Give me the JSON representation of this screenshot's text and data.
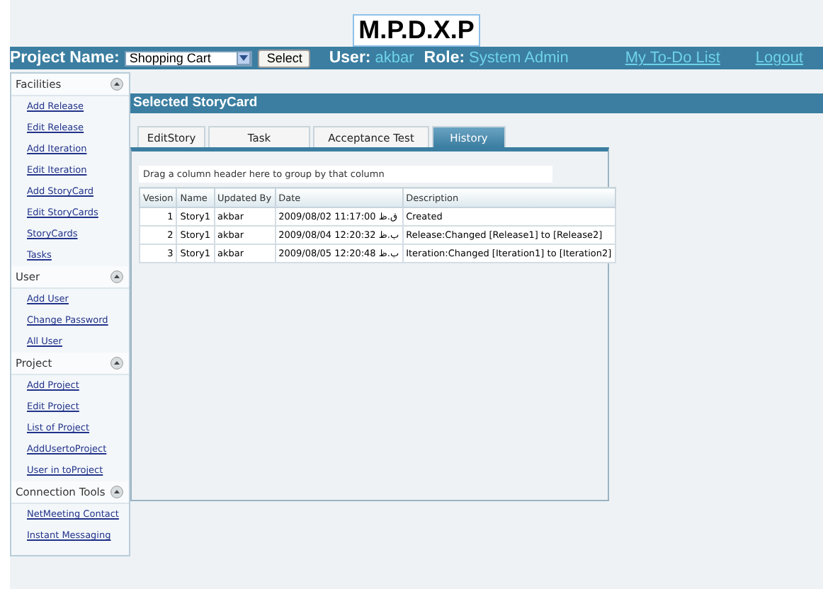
{
  "app_title": "M.P.D.X.P",
  "header": {
    "project_label": "Project Name:",
    "project_value": "Shopping Cart",
    "select_button": "Select",
    "user_label": "User:",
    "user_value": "akbar",
    "role_label": "Role:",
    "role_value": "System Admin",
    "todo_link": "My To-Do List",
    "logout_link": "Logout"
  },
  "sidebar": [
    {
      "title": "Facilities",
      "expanded": true,
      "items": [
        "Add Release",
        "Edit Release",
        "Add Iteration",
        "Edit Iteration",
        "Add StoryCard",
        "Edit StoryCards",
        "StoryCards",
        "Tasks"
      ]
    },
    {
      "title": "User",
      "expanded": true,
      "items": [
        "Add User",
        "Change Password",
        "All User"
      ]
    },
    {
      "title": "Project",
      "expanded": true,
      "items": [
        "Add Project",
        "Edit Project",
        "List of Project",
        "AddUsertoProject",
        "User in toProject"
      ]
    },
    {
      "title": "Connection Tools",
      "expanded": true,
      "items": [
        "NetMeeting Contact",
        "Instant Messaging"
      ]
    }
  ],
  "section_title": "Selected StoryCard",
  "tabs": [
    {
      "label": "EditStory",
      "selected": false
    },
    {
      "label": "Task",
      "selected": false
    },
    {
      "label": "Acceptance Test",
      "selected": false
    },
    {
      "label": "History",
      "selected": true
    }
  ],
  "group_hint": "Drag a column header here to group by that column",
  "table": {
    "columns": [
      "Vesion",
      "Name",
      "Updated By",
      "Date",
      "Description"
    ],
    "rows": [
      [
        "1",
        "Story1",
        "akbar",
        "2009/08/02 11:17:00 ق.ظ",
        "Created"
      ],
      [
        "2",
        "Story1",
        "akbar",
        "2009/08/04 12:20:32 ب.ظ",
        "Release:Changed [Release1] to [Release2]"
      ],
      [
        "3",
        "Story1",
        "akbar",
        "2009/08/05 12:20:48 ب.ظ",
        "Iteration:Changed [Iteration1] to [Iteration2]"
      ]
    ]
  }
}
